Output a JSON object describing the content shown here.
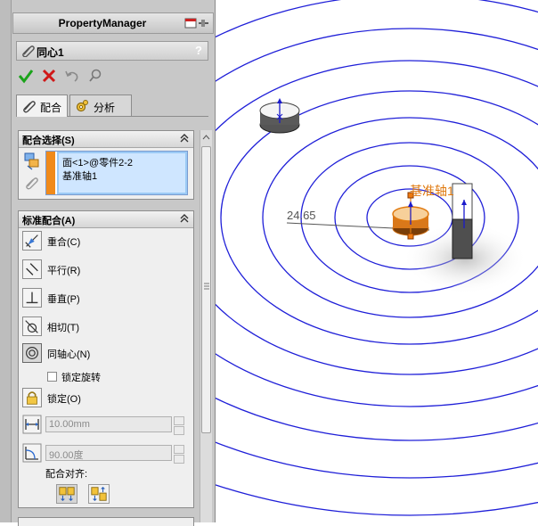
{
  "panel": {
    "title": "PropertyManager",
    "feature_title": "同心1",
    "help_label": "?"
  },
  "toolbar": {
    "icons": [
      "ok-check-icon",
      "cancel-x-icon",
      "undo-icon",
      "pushpin-icon"
    ]
  },
  "tabs": [
    {
      "label": "配合",
      "icon": "paperclip-icon",
      "selected": true
    },
    {
      "label": "分析",
      "icon": "gear-analysis-icon",
      "selected": false
    }
  ],
  "mate_selections": {
    "header": "配合选择(S)",
    "items": [
      "面<1>@零件2-2",
      "基准轴1"
    ]
  },
  "standard_mates": {
    "header": "标准配合(A)",
    "items": [
      {
        "label": "重合(C)",
        "icon": "coincident-icon",
        "active": false
      },
      {
        "label": "平行(R)",
        "icon": "parallel-icon",
        "active": false
      },
      {
        "label": "垂直(P)",
        "icon": "perpendicular-icon",
        "active": false
      },
      {
        "label": "相切(T)",
        "icon": "tangent-icon",
        "active": false
      },
      {
        "label": "同轴心(N)",
        "icon": "concentric-icon",
        "active": true
      }
    ],
    "lock_rotation_label": "锁定旋转",
    "lock_rotation_checked": false,
    "lock_label": "锁定(O)",
    "distance_value": "10.00mm",
    "angle_value": "90.00度",
    "alignment_label": "配合对齐:"
  },
  "viewport": {
    "dimension_label": "24.65",
    "axis_label": "基准轴1",
    "colors": {
      "rings": "#1f1fd8",
      "selection": "#f08a1a",
      "axis": "#e07a10"
    }
  }
}
